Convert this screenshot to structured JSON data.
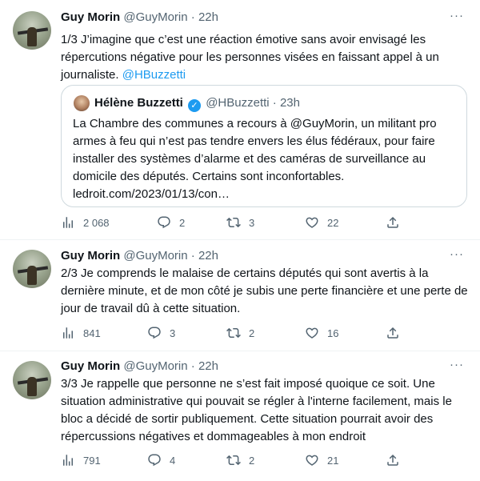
{
  "tweets": [
    {
      "name": "Guy Morin",
      "handle": "@GuyMorin",
      "separator": "·",
      "time": "22h",
      "more_icon": "···",
      "text": "1/3 J’imagine  que c’est une réaction émotive sans avoir envisagé les répercutions négative pour les personnes visées en faissant appel à un journaliste.",
      "mention": "@HBuzzetti",
      "quote": {
        "name": "Hélène Buzzetti",
        "verified_icon": "✓",
        "handle": "@HBuzzetti",
        "separator": "·",
        "time": "23h",
        "text": "La Chambre des communes a recours à @GuyMorin, un militant pro armes à feu qui n’est pas tendre envers les élus fédéraux, pour faire installer des systèmes d’alarme et des caméras de surveillance au domicile des députés. Certains sont inconfortables.",
        "link": "ledroit.com/2023/01/13/con…"
      },
      "stats": {
        "views": "2 068",
        "replies": "2",
        "retweets": "3",
        "likes": "22"
      }
    },
    {
      "name": "Guy Morin",
      "handle": "@GuyMorin",
      "separator": "·",
      "time": "22h",
      "more_icon": "···",
      "text": "2/3 Je comprends le malaise de certains députés qui sont avertis à la dernière minute, et de mon côté je subis une perte financière et une perte de jour de travail dû à cette situation.",
      "stats": {
        "views": "841",
        "replies": "3",
        "retweets": "2",
        "likes": "16"
      }
    },
    {
      "name": "Guy Morin",
      "handle": "@GuyMorin",
      "separator": "·",
      "time": "22h",
      "more_icon": "···",
      "text": "3/3 Je rappelle que personne ne s’est fait imposé quoique ce soit. Une situation administrative qui pouvait se régler à l'interne facilement, mais le bloc a décidé de sortir publiquement. Cette situation pourrait avoir des répercussions négatives et dommageables à mon endroit",
      "stats": {
        "views": "791",
        "replies": "4",
        "retweets": "2",
        "likes": "21"
      }
    }
  ],
  "colors": {
    "text": "#0f1419",
    "secondary": "#536471",
    "link": "#1d9bf0",
    "border": "#cfd9de",
    "divider": "#eff3f4"
  },
  "icons": [
    "views-icon",
    "reply-icon",
    "retweet-icon",
    "like-icon",
    "share-icon",
    "more-icon",
    "verified-icon"
  ]
}
